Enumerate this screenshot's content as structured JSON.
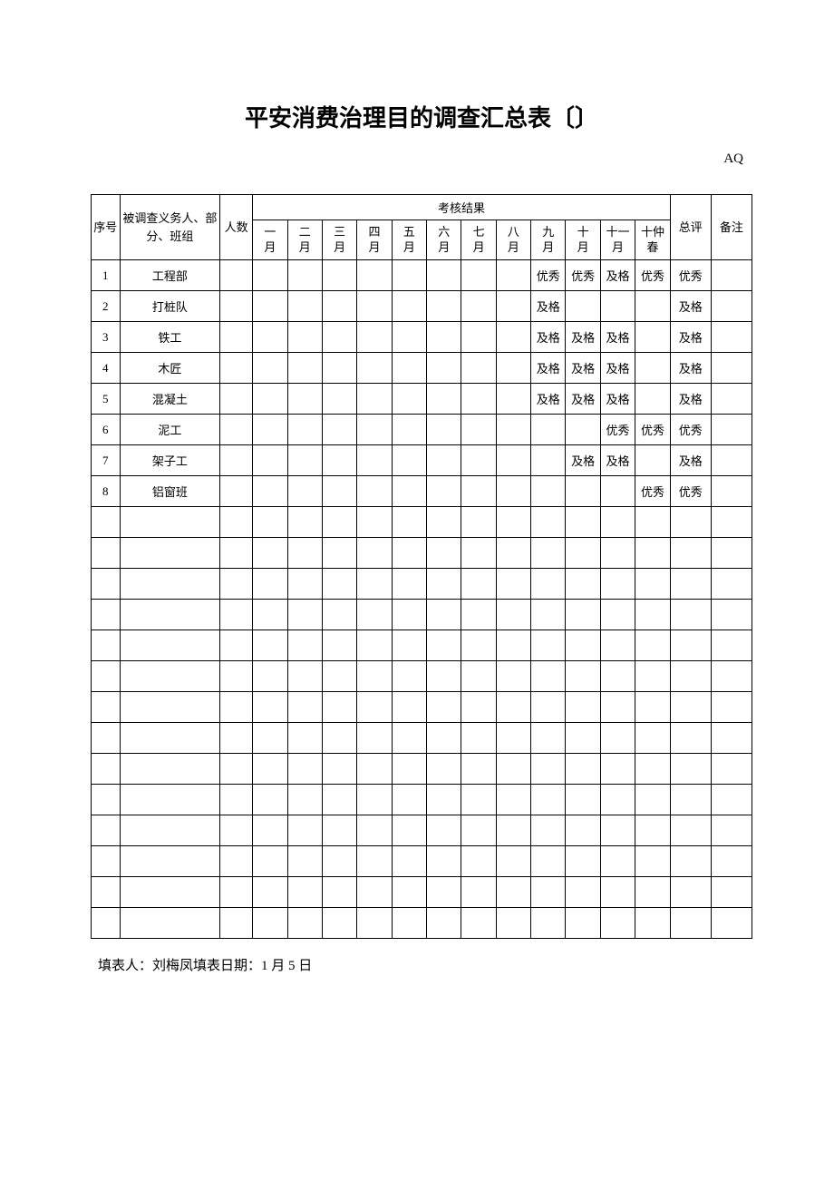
{
  "title": "平安消费治理目的调查汇总表〔〕",
  "code": "AQ",
  "headers": {
    "seq": "序号",
    "name": "被调查义务人、部分、班组",
    "count": "人数",
    "result_group": "考核结果",
    "months": [
      "一月",
      "二月",
      "三月",
      "四月",
      "五月",
      "六月",
      "七月",
      "八月",
      "九月",
      "十月",
      "十一月",
      "十仲春"
    ],
    "summary": "总评",
    "remark": "备注"
  },
  "rows": [
    {
      "seq": "1",
      "name": "工程部",
      "count": "",
      "months": [
        "",
        "",
        "",
        "",
        "",
        "",
        "",
        "",
        "优秀",
        "优秀",
        "及格",
        "优秀"
      ],
      "summary": "优秀",
      "remark": ""
    },
    {
      "seq": "2",
      "name": "打桩队",
      "count": "",
      "months": [
        "",
        "",
        "",
        "",
        "",
        "",
        "",
        "",
        "及格",
        "",
        "",
        ""
      ],
      "summary": "及格",
      "remark": ""
    },
    {
      "seq": "3",
      "name": "铁工",
      "count": "",
      "months": [
        "",
        "",
        "",
        "",
        "",
        "",
        "",
        "",
        "及格",
        "及格",
        "及格",
        ""
      ],
      "summary": "及格",
      "remark": ""
    },
    {
      "seq": "4",
      "name": "木匠",
      "count": "",
      "months": [
        "",
        "",
        "",
        "",
        "",
        "",
        "",
        "",
        "及格",
        "及格",
        "及格",
        ""
      ],
      "summary": "及格",
      "remark": ""
    },
    {
      "seq": "5",
      "name": "混凝土",
      "count": "",
      "months": [
        "",
        "",
        "",
        "",
        "",
        "",
        "",
        "",
        "及格",
        "及格",
        "及格",
        ""
      ],
      "summary": "及格",
      "remark": ""
    },
    {
      "seq": "6",
      "name": "泥工",
      "count": "",
      "months": [
        "",
        "",
        "",
        "",
        "",
        "",
        "",
        "",
        "",
        "",
        "优秀",
        "优秀"
      ],
      "summary": "优秀",
      "remark": ""
    },
    {
      "seq": "7",
      "name": "架子工",
      "count": "",
      "months": [
        "",
        "",
        "",
        "",
        "",
        "",
        "",
        "",
        "",
        "及格",
        "及格",
        ""
      ],
      "summary": "及格",
      "remark": ""
    },
    {
      "seq": "8",
      "name": "铝窗班",
      "count": "",
      "months": [
        "",
        "",
        "",
        "",
        "",
        "",
        "",
        "",
        "",
        "",
        "",
        "优秀"
      ],
      "summary": "优秀",
      "remark": ""
    },
    {
      "seq": "",
      "name": "",
      "count": "",
      "months": [
        "",
        "",
        "",
        "",
        "",
        "",
        "",
        "",
        "",
        "",
        "",
        ""
      ],
      "summary": "",
      "remark": ""
    },
    {
      "seq": "",
      "name": "",
      "count": "",
      "months": [
        "",
        "",
        "",
        "",
        "",
        "",
        "",
        "",
        "",
        "",
        "",
        ""
      ],
      "summary": "",
      "remark": ""
    },
    {
      "seq": "",
      "name": "",
      "count": "",
      "months": [
        "",
        "",
        "",
        "",
        "",
        "",
        "",
        "",
        "",
        "",
        "",
        ""
      ],
      "summary": "",
      "remark": ""
    },
    {
      "seq": "",
      "name": "",
      "count": "",
      "months": [
        "",
        "",
        "",
        "",
        "",
        "",
        "",
        "",
        "",
        "",
        "",
        ""
      ],
      "summary": "",
      "remark": ""
    },
    {
      "seq": "",
      "name": "",
      "count": "",
      "months": [
        "",
        "",
        "",
        "",
        "",
        "",
        "",
        "",
        "",
        "",
        "",
        ""
      ],
      "summary": "",
      "remark": ""
    },
    {
      "seq": "",
      "name": "",
      "count": "",
      "months": [
        "",
        "",
        "",
        "",
        "",
        "",
        "",
        "",
        "",
        "",
        "",
        ""
      ],
      "summary": "",
      "remark": ""
    },
    {
      "seq": "",
      "name": "",
      "count": "",
      "months": [
        "",
        "",
        "",
        "",
        "",
        "",
        "",
        "",
        "",
        "",
        "",
        ""
      ],
      "summary": "",
      "remark": ""
    },
    {
      "seq": "",
      "name": "",
      "count": "",
      "months": [
        "",
        "",
        "",
        "",
        "",
        "",
        "",
        "",
        "",
        "",
        "",
        ""
      ],
      "summary": "",
      "remark": ""
    },
    {
      "seq": "",
      "name": "",
      "count": "",
      "months": [
        "",
        "",
        "",
        "",
        "",
        "",
        "",
        "",
        "",
        "",
        "",
        ""
      ],
      "summary": "",
      "remark": ""
    },
    {
      "seq": "",
      "name": "",
      "count": "",
      "months": [
        "",
        "",
        "",
        "",
        "",
        "",
        "",
        "",
        "",
        "",
        "",
        ""
      ],
      "summary": "",
      "remark": ""
    },
    {
      "seq": "",
      "name": "",
      "count": "",
      "months": [
        "",
        "",
        "",
        "",
        "",
        "",
        "",
        "",
        "",
        "",
        "",
        ""
      ],
      "summary": "",
      "remark": ""
    },
    {
      "seq": "",
      "name": "",
      "count": "",
      "months": [
        "",
        "",
        "",
        "",
        "",
        "",
        "",
        "",
        "",
        "",
        "",
        ""
      ],
      "summary": "",
      "remark": ""
    },
    {
      "seq": "",
      "name": "",
      "count": "",
      "months": [
        "",
        "",
        "",
        "",
        "",
        "",
        "",
        "",
        "",
        "",
        "",
        ""
      ],
      "summary": "",
      "remark": ""
    },
    {
      "seq": "",
      "name": "",
      "count": "",
      "months": [
        "",
        "",
        "",
        "",
        "",
        "",
        "",
        "",
        "",
        "",
        "",
        ""
      ],
      "summary": "",
      "remark": ""
    }
  ],
  "footer": "填表人：刘梅凤填表日期：1 月 5 日"
}
